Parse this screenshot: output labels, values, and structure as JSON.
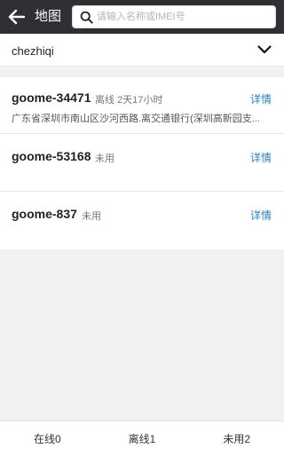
{
  "header": {
    "back_icon": "arrow-left-icon",
    "title": "地图",
    "search": {
      "icon": "search-icon",
      "placeholder": "请输入名称或IMEI号",
      "value": ""
    }
  },
  "dropdown": {
    "value": "chezhiqi",
    "icon": "chevron-down-icon"
  },
  "devices": [
    {
      "name": "goome-34471",
      "status": "离线",
      "duration": "2天17小时",
      "detail_label": "详情",
      "address": "广东省深圳市南山区沙河西路.离交通银行(深圳高新园支..."
    },
    {
      "name": "goome-53168",
      "status": "未用",
      "detail_label": "详情"
    },
    {
      "name": "goome-837",
      "status": "未用",
      "detail_label": "详情"
    }
  ],
  "tabs": [
    {
      "label": "在线0"
    },
    {
      "label": "离线1"
    },
    {
      "label": "未用2"
    }
  ],
  "colors": {
    "header_bg": "#2f3034",
    "link": "#2a7fc0",
    "background": "#f1f1f1"
  }
}
